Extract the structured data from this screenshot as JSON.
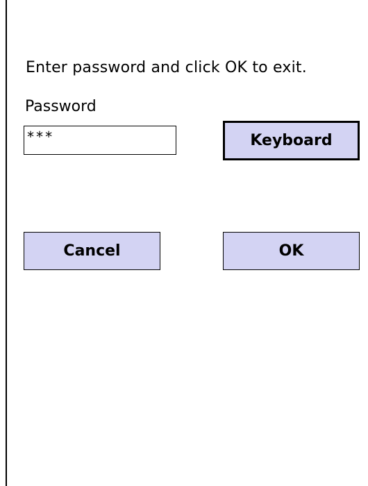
{
  "dialog": {
    "instruction": "Enter password and click OK to exit.",
    "password_label": "Password",
    "password_value": "***"
  },
  "buttons": {
    "keyboard_label": "Keyboard",
    "cancel_label": "Cancel",
    "ok_label": "OK"
  },
  "colors": {
    "button_fill": "#d3d3f3",
    "border": "#000000",
    "background": "#ffffff"
  }
}
